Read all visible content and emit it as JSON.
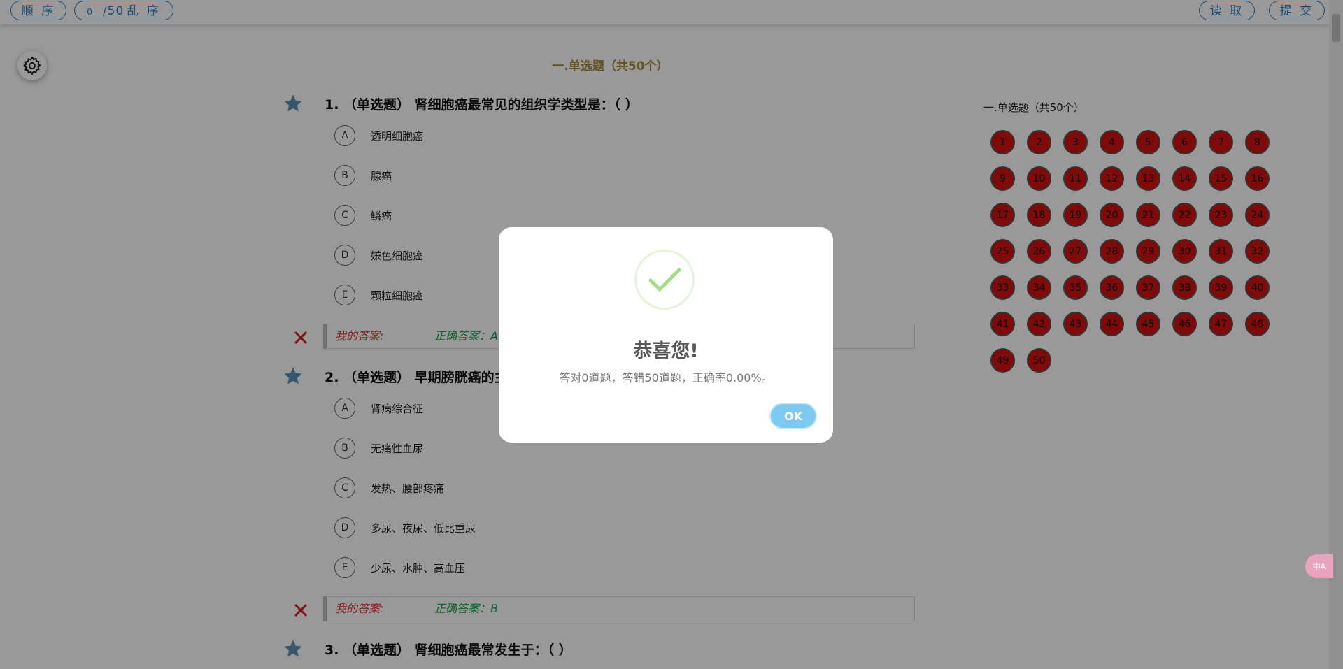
{
  "topbar": {
    "order_label": "顺 序",
    "progress_count": "0",
    "progress_total": "/50",
    "shuffle_label": "乱 序",
    "read_label": "读 取",
    "submit_label": "提 交"
  },
  "section_title": "一.单选题（共50个）",
  "questions": [
    {
      "title": "1. （单选题） 肾细胞癌最常见的组织学类型是：（ ）",
      "options": [
        {
          "letter": "A",
          "text": "透明细胞癌"
        },
        {
          "letter": "B",
          "text": "腺癌"
        },
        {
          "letter": "C",
          "text": "鳞癌"
        },
        {
          "letter": "D",
          "text": "嫌色细胞癌"
        },
        {
          "letter": "E",
          "text": "颗粒细胞癌"
        }
      ],
      "my_answer": "我的答案:",
      "correct_answer": "正确答案：A"
    },
    {
      "title": "2. （单选题） 早期膀胱癌的主",
      "options": [
        {
          "letter": "A",
          "text": "肾病综合征"
        },
        {
          "letter": "B",
          "text": "无痛性血尿"
        },
        {
          "letter": "C",
          "text": "发热、腰部疼痛"
        },
        {
          "letter": "D",
          "text": "多尿、夜尿、低比重尿"
        },
        {
          "letter": "E",
          "text": "少尿、水肿、高血压"
        }
      ],
      "my_answer": "我的答案:",
      "correct_answer": "正确答案：B"
    },
    {
      "title": "3. （单选题） 肾细胞癌最常发生于：（ ）"
    }
  ],
  "answer_sheet": {
    "title": "一.单选题（共50个）",
    "numbers": [
      "1",
      "2",
      "3",
      "4",
      "5",
      "6",
      "7",
      "8",
      "9",
      "10",
      "11",
      "12",
      "13",
      "14",
      "15",
      "16",
      "17",
      "18",
      "19",
      "20",
      "21",
      "22",
      "23",
      "24",
      "25",
      "26",
      "27",
      "28",
      "29",
      "30",
      "31",
      "32",
      "33",
      "34",
      "35",
      "36",
      "37",
      "38",
      "39",
      "40",
      "41",
      "42",
      "43",
      "44",
      "45",
      "46",
      "47",
      "48",
      "49",
      "50"
    ],
    "wrong_color": "#d41212"
  },
  "modal": {
    "title": "恭喜您!",
    "text": "答对0道题，答错50道题，正确率0.00%。",
    "ok_label": "OK",
    "accent": "#a5dc86"
  },
  "translate_badge": "中A"
}
